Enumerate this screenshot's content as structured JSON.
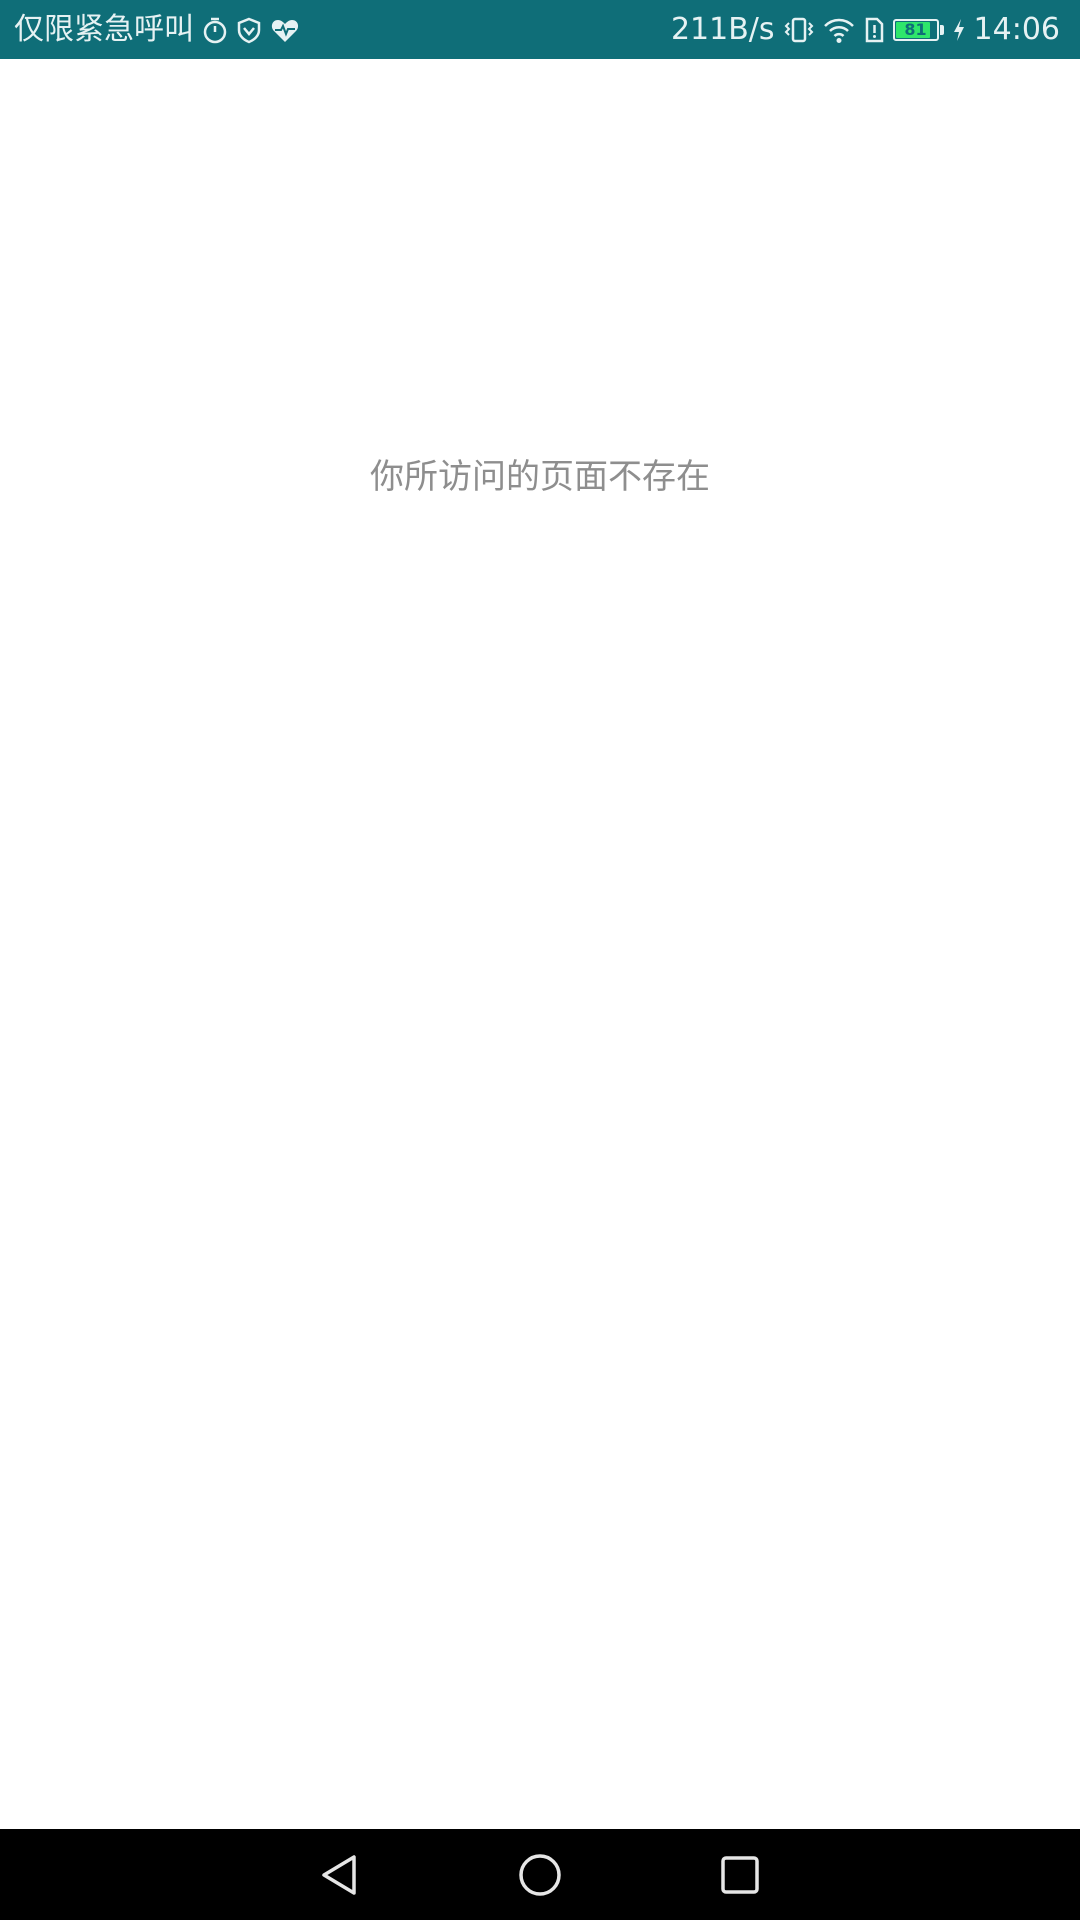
{
  "status_bar": {
    "carrier_text": "仅限紧急呼叫",
    "left_icons": [
      "stopwatch-icon",
      "shield-icon",
      "heart-pulse-icon"
    ],
    "network_speed": "211B/s",
    "right_icons": [
      "vibrate-icon",
      "wifi-icon",
      "sim-alert-icon",
      "battery-icon",
      "charging-icon"
    ],
    "battery_level": "81",
    "battery_percent": 81,
    "time": "14:06",
    "background_color": "#0f6e78",
    "battery_color": "#2ee66b"
  },
  "main": {
    "message": "你所访问的页面不存在"
  },
  "nav_bar": {
    "buttons": [
      "back-icon",
      "home-icon",
      "recent-apps-icon"
    ]
  }
}
